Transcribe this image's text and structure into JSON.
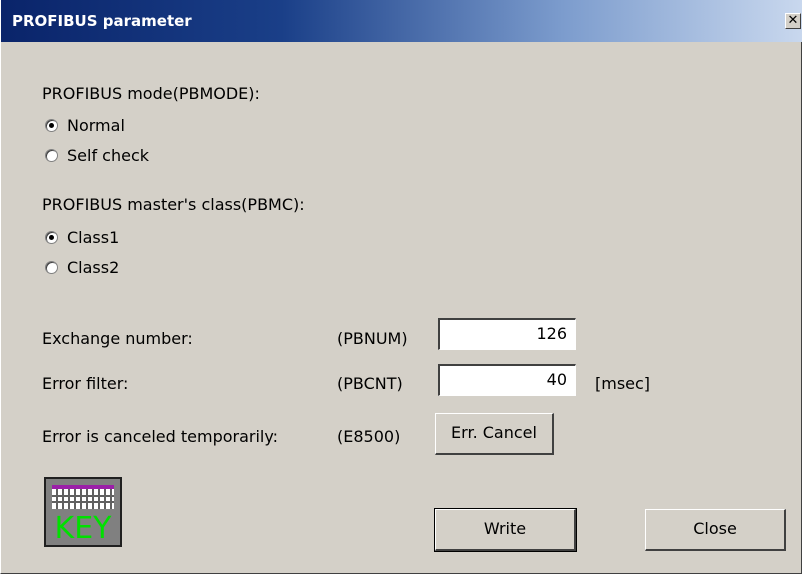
{
  "window": {
    "title": "PROFIBUS parameter",
    "close_glyph": "✕"
  },
  "mode_group": {
    "label": "PROFIBUS mode(PBMODE):",
    "options": [
      {
        "label": "Normal",
        "checked": true
      },
      {
        "label": "Self check",
        "checked": false
      }
    ]
  },
  "class_group": {
    "label": "PROFIBUS master's class(PBMC):",
    "options": [
      {
        "label": "Class1",
        "checked": true
      },
      {
        "label": "Class2",
        "checked": false
      }
    ]
  },
  "exchange": {
    "label": "Exchange number:",
    "code": "(PBNUM)",
    "value": "126"
  },
  "error_filter": {
    "label": "Error filter:",
    "code": "(PBCNT)",
    "value": "40",
    "unit": "[msec]"
  },
  "error_cancel": {
    "label": "Error is canceled temporarily:",
    "code": "(E8500)",
    "button_label": "Err. Cancel"
  },
  "key_icon": {
    "text": "KEY"
  },
  "buttons": {
    "write": "Write",
    "close": "Close"
  }
}
